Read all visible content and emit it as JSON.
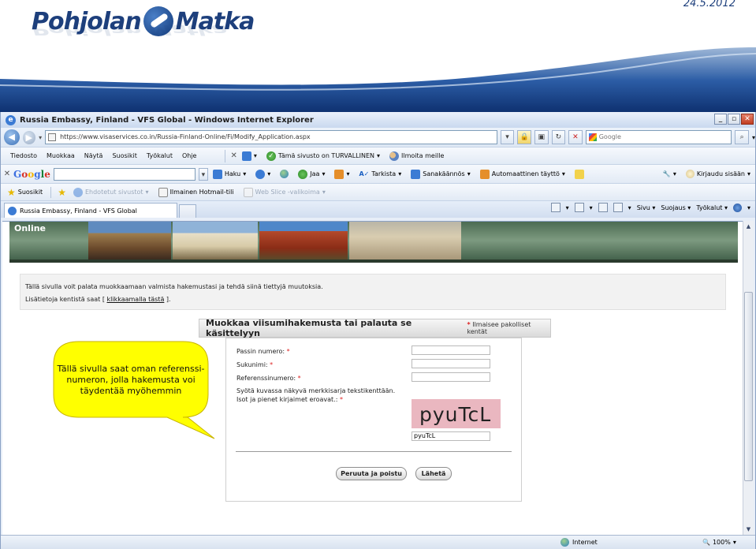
{
  "slide": {
    "brand_left": "Pohjolan",
    "brand_right": "Matka",
    "date": "24.5.2012"
  },
  "window": {
    "title": "Russia Embassy, Finland - VFS Global - Windows Internet Explorer",
    "url": "https://www.visaservices.co.in/Russia-Finland-Online/Fi/Modify_Application.aspx",
    "search_placeholder": "Google"
  },
  "menubar": {
    "items": [
      "Tiedosto",
      "Muokkaa",
      "Näytä",
      "Suosikit",
      "Työkalut",
      "Ohje"
    ],
    "secure_label": "Tämä sivusto on TURVALLINEN",
    "report_label": "Ilmoita meille"
  },
  "googlebar": {
    "search_label": "Haku",
    "share_label": "Jaa",
    "check_label": "Tarkista",
    "translate_label": "Sanakäännös",
    "autofill_label": "Automaattinen täyttö",
    "signin_label": "Kirjaudu sisään"
  },
  "favbar": {
    "favorites_label": "Suosikit",
    "suggested_label": "Ehdotetut sivustot",
    "hotmail_label": "Ilmainen Hotmail-tili",
    "webslice_label": "Web Slice -valikoima"
  },
  "tabbar": {
    "tab_label": "Russia Embassy, Finland - VFS Global",
    "page_label": "Sivu",
    "safety_label": "Suojaus",
    "tools_label": "Työkalut"
  },
  "page": {
    "banner_title": "Online",
    "info_line1": "Tällä sivulla voit palata muokkaamaan valmista hakemustasi ja tehdä siinä tiettyjä muutoksia.",
    "info_line2_prefix": "Lisätietoja kentistä saat [",
    "info_link": "klikkaamalla tästä",
    "info_line2_suffix": "].",
    "form_title": "Muokkaa viisumihakemusta tai palauta se käsittelyyn",
    "required_note": "Ilmaisee pakolliset kentät",
    "passport_label": "Passin numero:",
    "surname_label": "Sukunimi:",
    "reference_label": "Referenssinumero:",
    "captcha_label_line1": "Syötä kuvassa näkyvä merkkisarja tekstikenttään.",
    "captcha_label_line2": "Isot ja pienet kirjaimet eroavat.:",
    "captcha_text": "pyuTcL",
    "captcha_input_value": "pyuTcL",
    "cancel_button": "Peruuta ja poistu",
    "submit_button": "Lähetä",
    "required_mark": "*"
  },
  "status": {
    "zone": "Internet",
    "zoom": "100%"
  },
  "callout": {
    "text": "Tällä sivulla saat oman referenssi-numeron, jolla hakemusta voi täydentää myöhemmin"
  }
}
